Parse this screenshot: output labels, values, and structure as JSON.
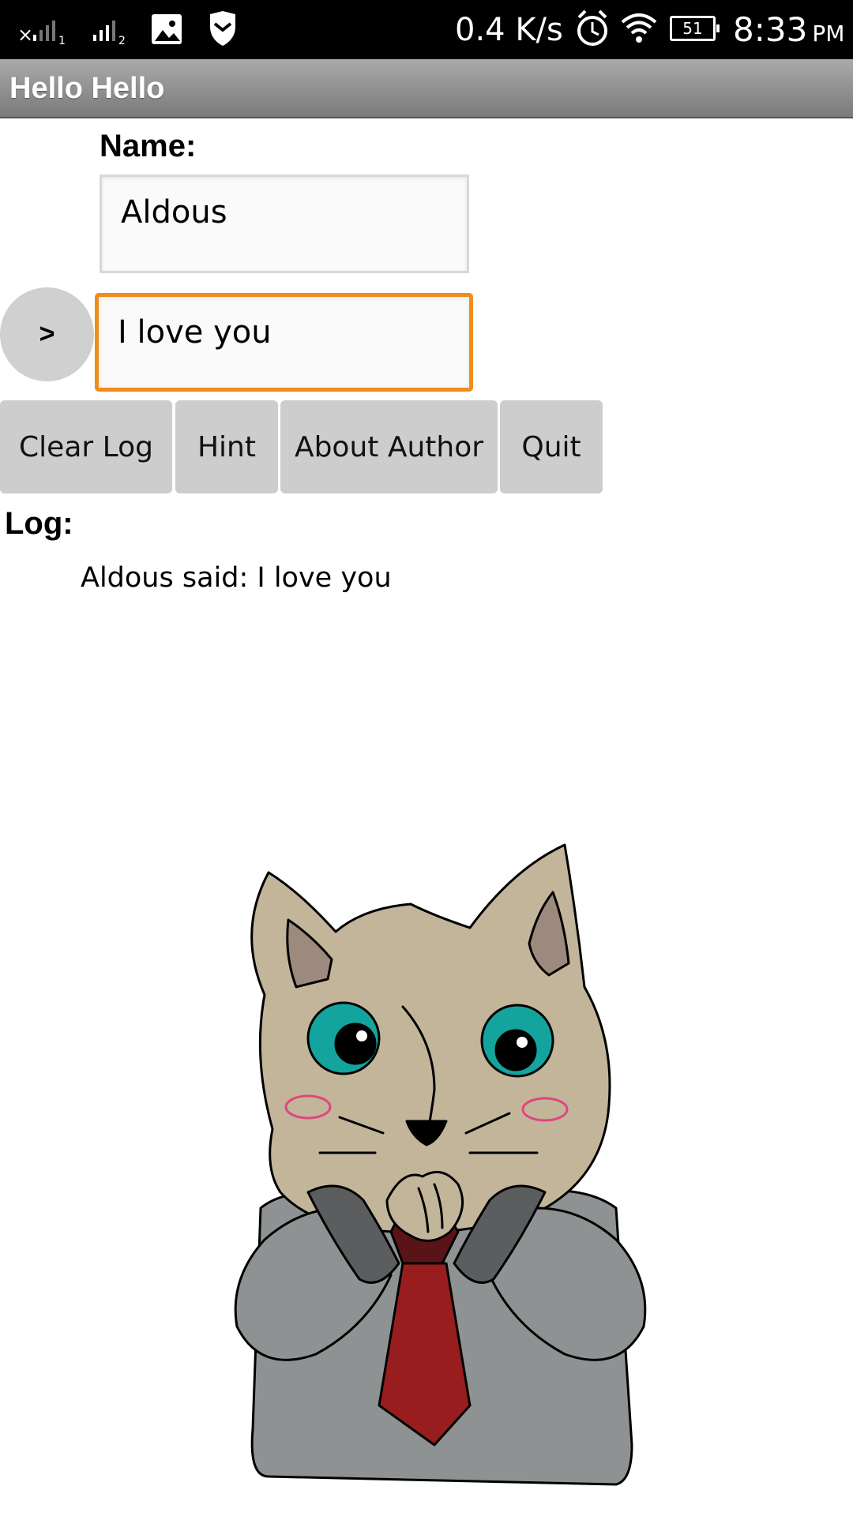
{
  "status_bar": {
    "network_speed": "0.4 K/s",
    "battery_level": "51",
    "time": "8:33",
    "ampm": "PM",
    "icons": [
      "signal-sim1-icon",
      "signal-sim2-icon",
      "image-icon",
      "shield-icon",
      "alarm-icon",
      "wifi-icon",
      "battery-icon"
    ]
  },
  "app": {
    "title": "Hello Hello"
  },
  "form": {
    "name_label": "Name:",
    "name_value": "Aldous",
    "message_value": "I love you",
    "send_label": ">"
  },
  "buttons": {
    "clear_log": "Clear Log",
    "hint": "Hint",
    "about_author": "About Author",
    "quit": "Quit"
  },
  "log": {
    "label": "Log:",
    "entries": [
      "Aldous said: I love you"
    ]
  },
  "colors": {
    "focus_border": "#f08c1c",
    "button_bg": "#cdcdcd",
    "title_bar": "#8f8f8f"
  }
}
